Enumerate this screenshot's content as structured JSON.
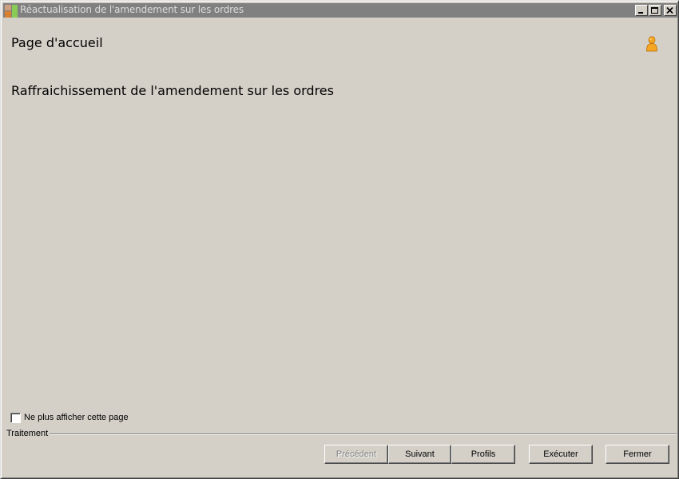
{
  "window": {
    "title": "Réactualisation de l'amendement sur les ordres",
    "app_icon": "wizard-app-icon",
    "controls": {
      "minimize_icon": "minimize-icon",
      "maximize_icon": "maximize-icon",
      "close_icon": "close-icon"
    }
  },
  "header": {
    "title": "Page d'accueil",
    "user_icon": "user-icon"
  },
  "main": {
    "heading": "Raffraichissement de l'amendement sur les ordres"
  },
  "options": {
    "dont_show_again": {
      "label": "Ne plus afficher cette page",
      "checked": false
    }
  },
  "footer": {
    "group_label": "Traitement",
    "buttons": {
      "previous": "Précédent",
      "next": "Suivant",
      "profiles": "Profils",
      "execute": "Exécuter",
      "close": "Fermer"
    }
  }
}
